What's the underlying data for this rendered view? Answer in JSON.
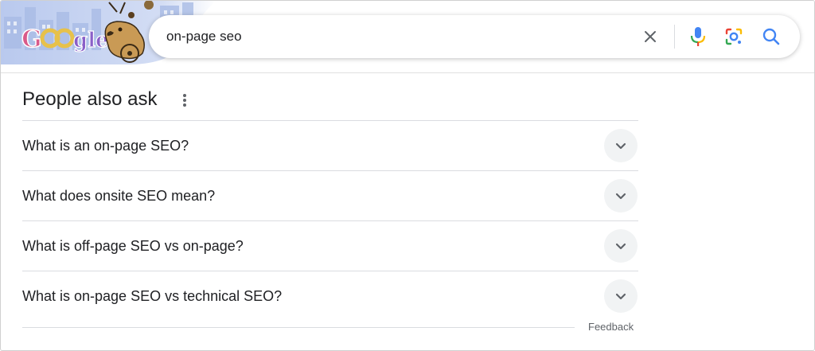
{
  "search": {
    "query": "on-page seo",
    "logo_text": "Google"
  },
  "paa": {
    "title": "People also ask",
    "questions": [
      "What is an on-page SEO?",
      "What does onsite SEO mean?",
      "What is off-page SEO vs on-page?",
      "What is on-page SEO vs technical SEO?"
    ],
    "feedback_label": "Feedback"
  },
  "colors": {
    "text": "#202124",
    "divider": "#dadce0",
    "chevron_bg": "#f1f3f4",
    "google_blue": "#4285f4",
    "google_red": "#ea4335",
    "google_yellow": "#fbbc05",
    "google_green": "#34a853"
  },
  "icons": {
    "clear": "close-icon",
    "voice": "microphone-icon",
    "lens": "google-lens-icon",
    "search": "search-icon",
    "more": "more-vert-icon",
    "expand": "chevron-down-icon"
  }
}
